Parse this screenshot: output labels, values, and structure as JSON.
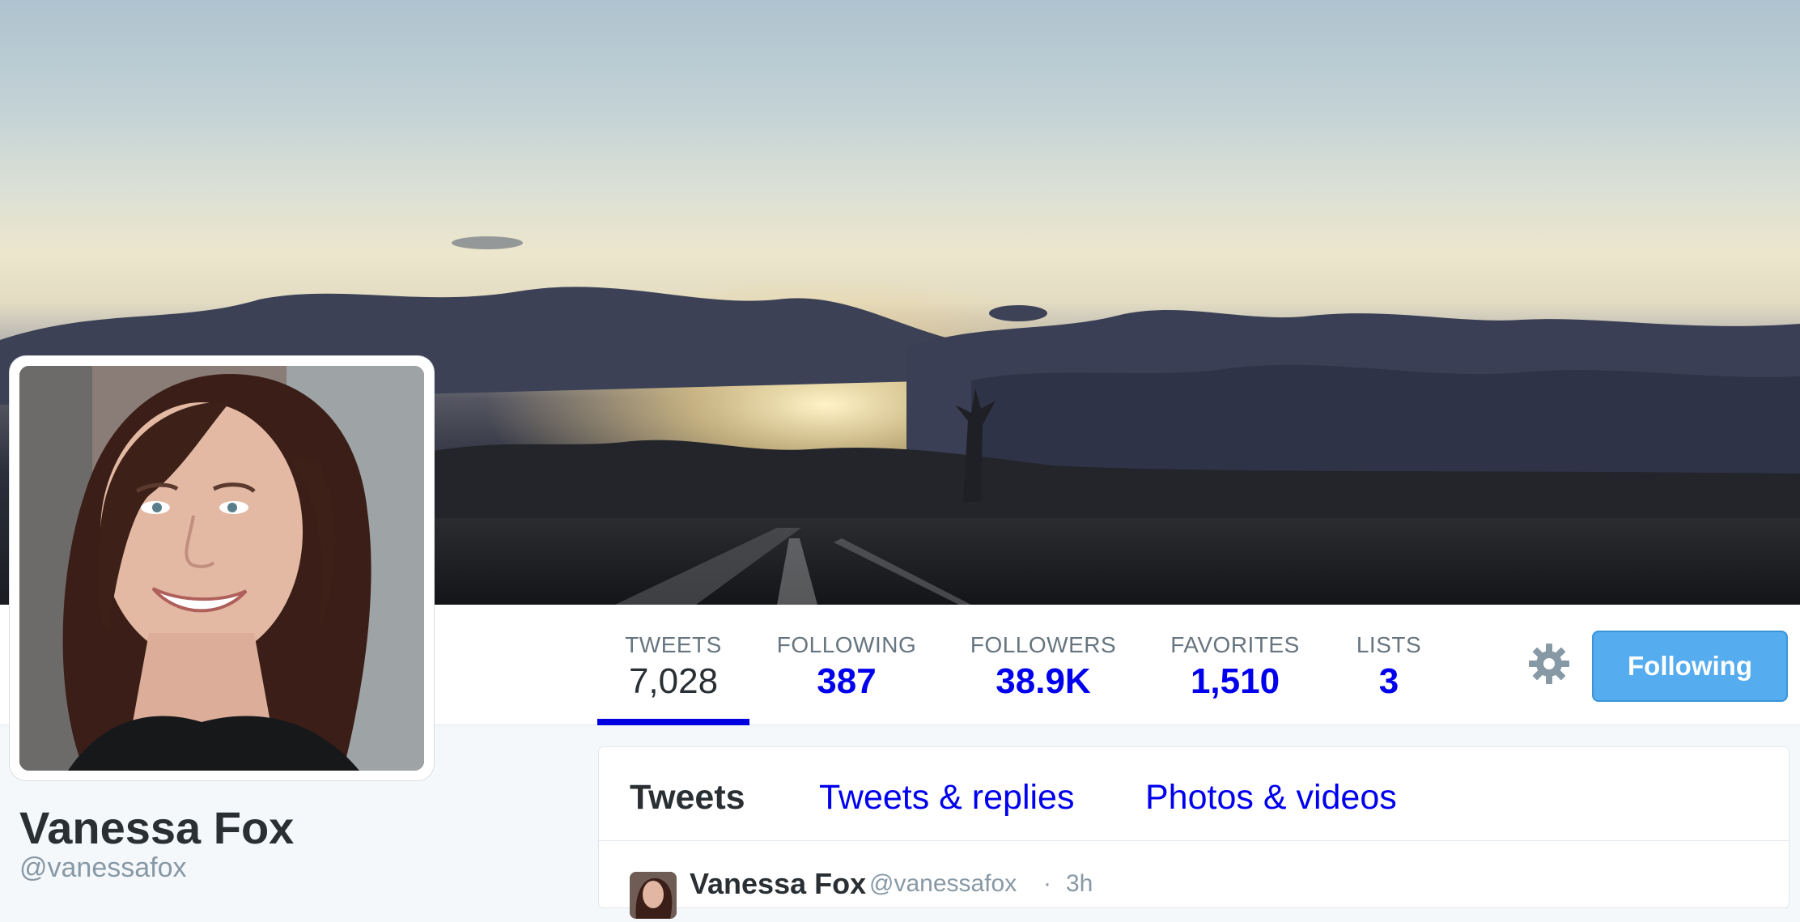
{
  "profile": {
    "name": "Vanessa Fox",
    "handle": "@vanessafox"
  },
  "stats": [
    {
      "label": "TWEETS",
      "value": "7,028",
      "active": true
    },
    {
      "label": "FOLLOWING",
      "value": "387"
    },
    {
      "label": "FOLLOWERS",
      "value": "38.9K"
    },
    {
      "label": "FAVORITES",
      "value": "1,510"
    },
    {
      "label": "LISTS",
      "value": "3"
    }
  ],
  "actions": {
    "settings_icon": "gear-icon",
    "follow_button_label": "Following"
  },
  "timeline": {
    "tabs": [
      {
        "label": "Tweets",
        "active": true
      },
      {
        "label": "Tweets & replies"
      },
      {
        "label": "Photos & videos"
      }
    ],
    "first_tweet": {
      "name": "Vanessa Fox",
      "handle": "@vanessafox",
      "separator": "·",
      "time": "3h"
    }
  },
  "colors": {
    "link": "#0000ee",
    "accent_blue": "#55acee",
    "active_tab_underline": "#0000e0",
    "muted_text": "#66757f",
    "page_background": "#f5f8fa"
  }
}
